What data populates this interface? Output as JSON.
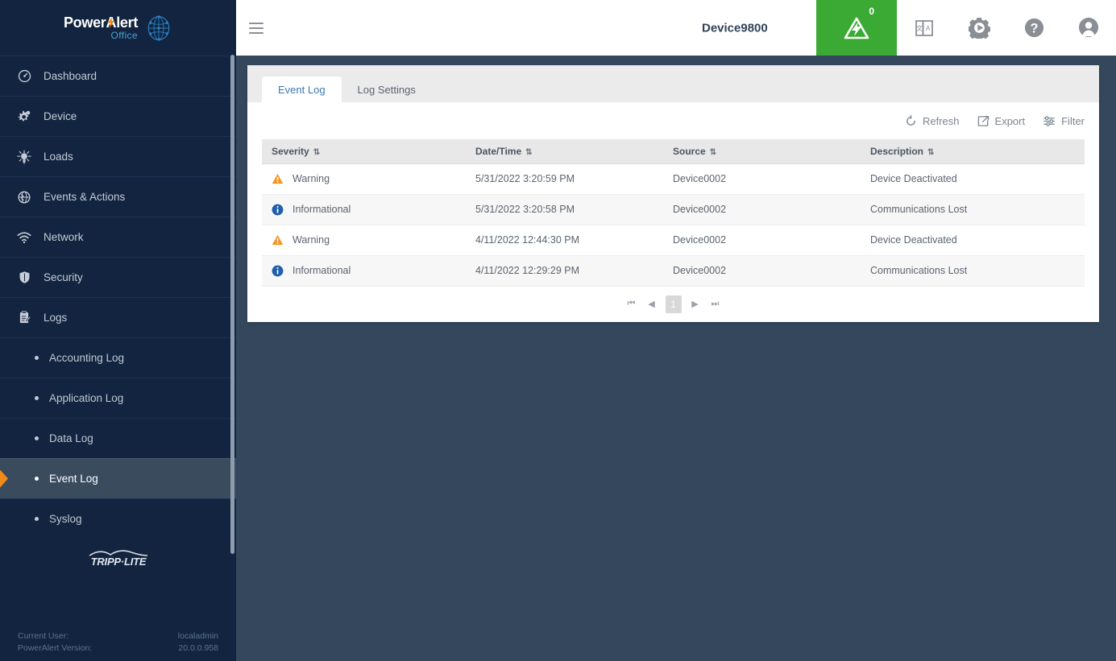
{
  "brand": {
    "logo_main": "PowerAlert",
    "logo_sub": "Office",
    "footer_logo": "TRIPP·LITE"
  },
  "sidebar": {
    "items": [
      {
        "label": "Dashboard",
        "icon": "dashboard-icon"
      },
      {
        "label": "Device",
        "icon": "device-gear-icon"
      },
      {
        "label": "Loads",
        "icon": "loads-icon"
      },
      {
        "label": "Events & Actions",
        "icon": "events-globe-icon"
      },
      {
        "label": "Network",
        "icon": "wifi-icon"
      },
      {
        "label": "Security",
        "icon": "shield-icon"
      },
      {
        "label": "Logs",
        "icon": "clipboard-icon"
      }
    ],
    "subitems": [
      {
        "label": "Accounting Log",
        "active": false
      },
      {
        "label": "Application Log",
        "active": false
      },
      {
        "label": "Data Log",
        "active": false
      },
      {
        "label": "Event Log",
        "active": true
      },
      {
        "label": "Syslog",
        "active": false
      }
    ],
    "footer": {
      "current_user_label": "Current User:",
      "current_user_value": "localadmin",
      "version_label": "PowerAlert Version:",
      "version_value": "20.0.0.958"
    }
  },
  "header": {
    "device_title": "Device9800",
    "alert_count": "0",
    "icons": [
      "alert-triangle-icon",
      "book-translate-icon",
      "gear-play-icon",
      "help-icon",
      "user-avatar-icon"
    ]
  },
  "main": {
    "tabs": [
      {
        "label": "Event Log",
        "active": true
      },
      {
        "label": "Log Settings",
        "active": false
      }
    ],
    "toolbar": {
      "refresh_label": "Refresh",
      "export_label": "Export",
      "filter_label": "Filter"
    },
    "table": {
      "columns": [
        "Severity",
        "Date/Time",
        "Source",
        "Description"
      ],
      "rows": [
        {
          "severity": "Warning",
          "severity_type": "warning",
          "datetime": "5/31/2022 3:20:59 PM",
          "source": "Device0002",
          "description": "Device Deactivated"
        },
        {
          "severity": "Informational",
          "severity_type": "info",
          "datetime": "5/31/2022 3:20:58 PM",
          "source": "Device0002",
          "description": "Communications Lost"
        },
        {
          "severity": "Warning",
          "severity_type": "warning",
          "datetime": "4/11/2022 12:44:30 PM",
          "source": "Device0002",
          "description": "Device Deactivated"
        },
        {
          "severity": "Informational",
          "severity_type": "info",
          "datetime": "4/11/2022 12:29:29 PM",
          "source": "Device0002",
          "description": "Communications Lost"
        }
      ]
    },
    "pagination": {
      "first": "⏮",
      "prev": "◀",
      "current_page": "1",
      "next": "▶",
      "last": "⏭"
    }
  },
  "colors": {
    "sidebar_bg": "#12243f",
    "main_bg": "#34475c",
    "accent_orange": "#f08a18",
    "alert_green": "#3aaa35",
    "tab_active_text": "#3b7ab5",
    "warning": "#f5941f",
    "info": "#1f5fad"
  }
}
